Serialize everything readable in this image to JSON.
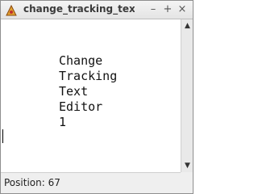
{
  "window": {
    "title": "change_tracking_text_edit",
    "minimize_glyph": "–",
    "maximize_glyph": "+",
    "close_glyph": "×"
  },
  "editor": {
    "lines": [
      "Change",
      "Tracking",
      "Text",
      "Editor",
      "1"
    ]
  },
  "scrollbar": {
    "up_glyph": "▲",
    "down_glyph": "▼"
  },
  "status": {
    "position_text": "Position: 67"
  },
  "icons": {
    "app_icon": "app-icon"
  }
}
